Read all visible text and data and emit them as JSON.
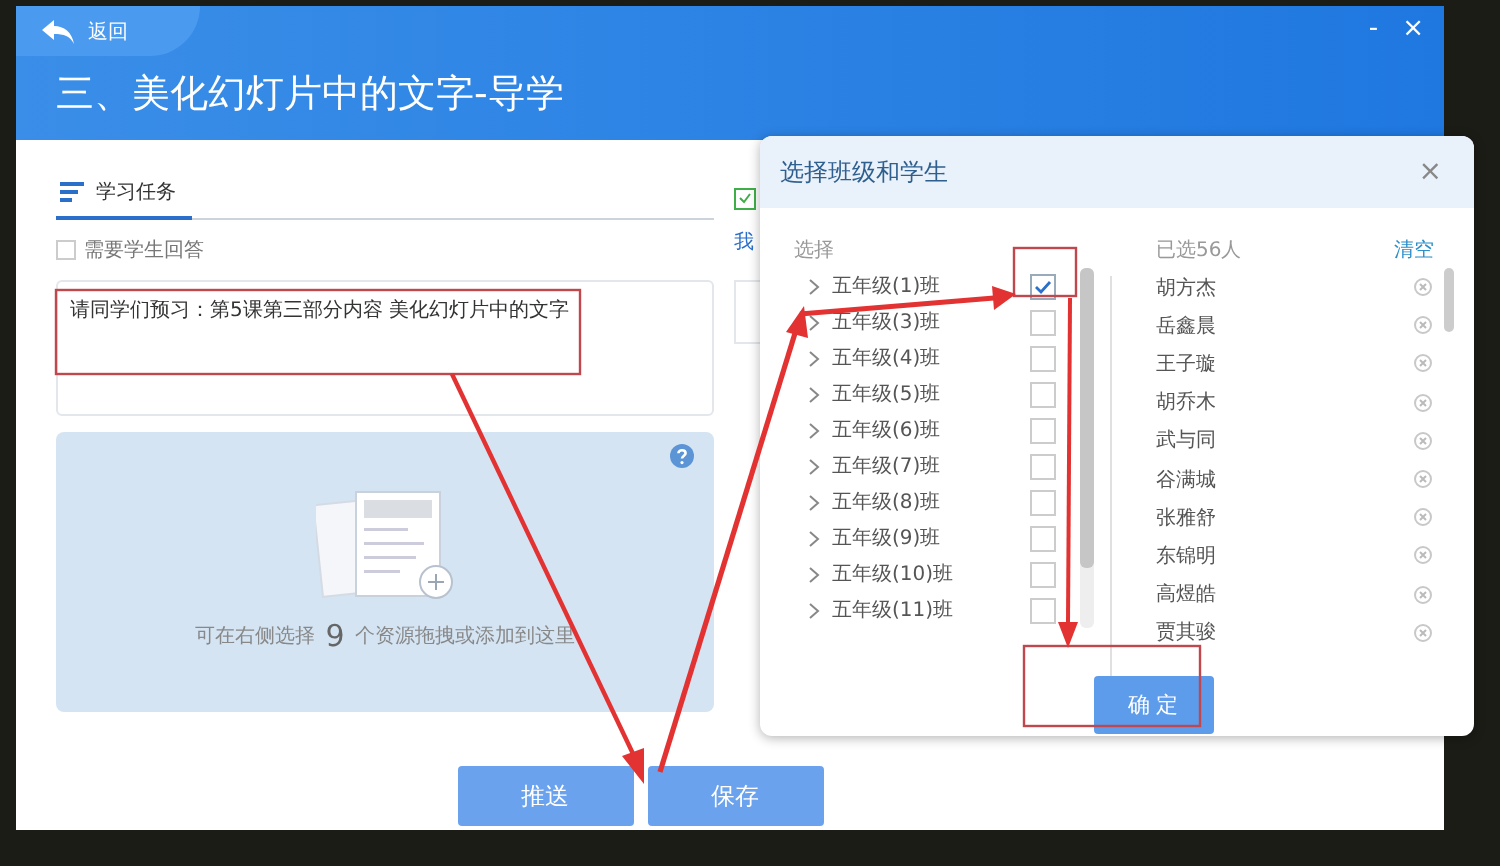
{
  "window": {
    "back": "返回",
    "title": "三、美化幻灯片中的文字-导学",
    "minimize": "-",
    "close": "×"
  },
  "task_panel": {
    "tab": "学习任务",
    "need_answer": {
      "label": "需要学生回答",
      "checked": false
    },
    "content": "请同学们预习：第5课第三部分内容 美化幻灯片中的文字",
    "hint_before": "可在右侧选择",
    "hint_count": "9",
    "hint_after": "个资源拖拽或添加到这里"
  },
  "side_panel": {
    "label": "我"
  },
  "buttons": [
    {
      "label": "推送"
    },
    {
      "label": "保存"
    }
  ],
  "dialog": {
    "title": "选择班级和学生",
    "close": "×",
    "choose_label": "选择",
    "selected_count": "已选56人",
    "clear": "清空",
    "classes": [
      {
        "name": "五年级(1)班",
        "checked": true
      },
      {
        "name": "五年级(3)班",
        "checked": false
      },
      {
        "name": "五年级(4)班",
        "checked": false
      },
      {
        "name": "五年级(5)班",
        "checked": false
      },
      {
        "name": "五年级(6)班",
        "checked": false
      },
      {
        "name": "五年级(7)班",
        "checked": false
      },
      {
        "name": "五年级(8)班",
        "checked": false
      },
      {
        "name": "五年级(9)班",
        "checked": false
      },
      {
        "name": "五年级(10)班",
        "checked": false
      },
      {
        "name": "五年级(11)班",
        "checked": false
      }
    ],
    "students": [
      "胡方杰",
      "岳鑫晨",
      "王子璇",
      "胡乔木",
      "武与同",
      "谷满城",
      "张雅舒",
      "东锦明",
      "高煜皓",
      "贾其骏"
    ],
    "confirm": "确 定"
  }
}
